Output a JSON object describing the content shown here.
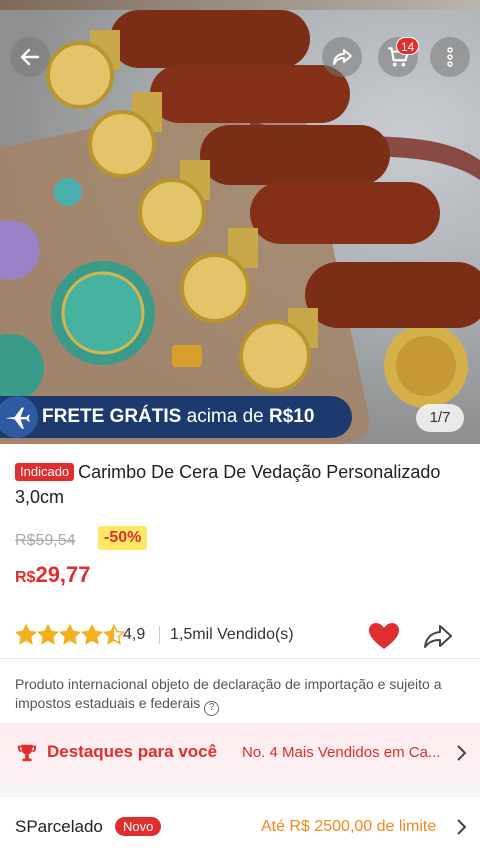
{
  "hero": {
    "pager": "1/7",
    "cart_count": "14",
    "frete": {
      "main": "FRETE GRÁTIS",
      "middle": " acima de ",
      "amount": "R$10"
    }
  },
  "product": {
    "badge": "Indicado",
    "title": "Carimbo De Cera De Vedação Personalizado 3,0cm",
    "old_price": "R$59,54",
    "discount": "-50%",
    "price_currency": "R$",
    "price_value": "29,77",
    "rating": "4,9",
    "rating_value": 4.5,
    "sold": "1,5mil Vendido(s)"
  },
  "notice": {
    "text": "Produto internacional objeto de declaração de importação e sujeito a impostos estaduais e federais"
  },
  "destaques": {
    "label": "Destaques para você",
    "value": "No. 4 Mais Vendidos em Ca..."
  },
  "parcelado": {
    "label": "SParcelado",
    "badge": "Novo",
    "value": "Até R$ 2500,00 de limite"
  },
  "colors": {
    "accent_red": "#e02d2d",
    "frete_blue": "#1c3a6e",
    "orange": "#f08a1a",
    "star_gold": "#f2b01e"
  },
  "icons": [
    "back-arrow-icon",
    "share-icon",
    "cart-icon",
    "more-icon",
    "airplane-icon",
    "star-icon",
    "heart-icon",
    "trophy-icon",
    "chevron-right-icon",
    "info-icon"
  ]
}
